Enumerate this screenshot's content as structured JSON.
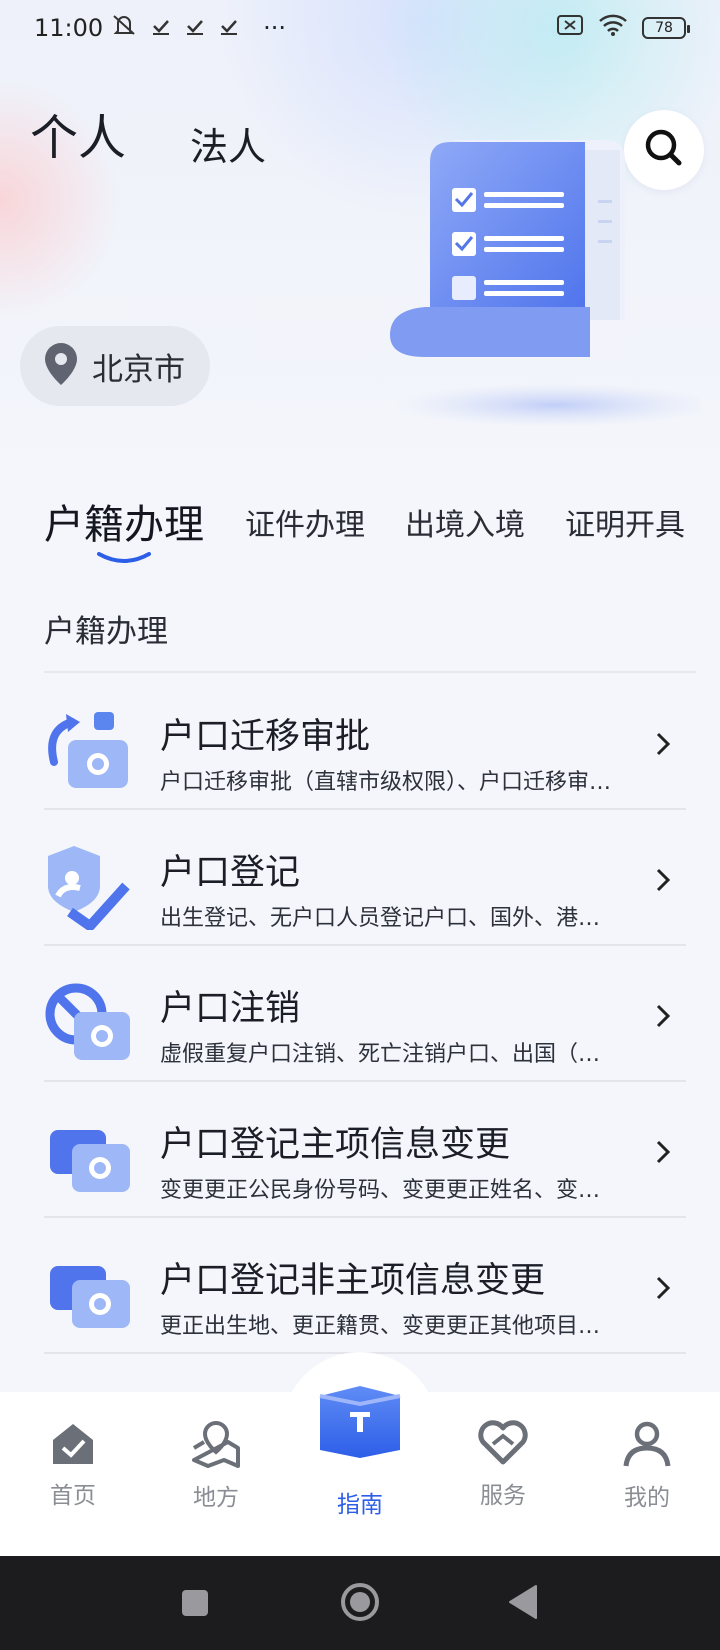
{
  "status_bar": {
    "time": "11:00",
    "ellipsis": "···",
    "battery": "78",
    "icons": [
      "mute-icon",
      "check-icon",
      "check-icon",
      "check-icon",
      "sim-icon",
      "wifi-icon",
      "battery-icon"
    ]
  },
  "top_tabs": [
    {
      "label": "个人",
      "active": true
    },
    {
      "label": "法人",
      "active": false
    }
  ],
  "location": {
    "label": "北京市"
  },
  "category_tabs": [
    {
      "label": "户籍办理",
      "active": true
    },
    {
      "label": "证件办理",
      "active": false
    },
    {
      "label": "出境入境",
      "active": false
    },
    {
      "label": "证明开具",
      "active": false
    }
  ],
  "section_title": "户籍办理",
  "items": [
    {
      "title": "户口迁移审批",
      "desc": "户口迁移审批（直辖市级权限）、户口迁移审批（非直辖市级权限）",
      "icon": "transfer-icon"
    },
    {
      "title": "户口登记",
      "desc": "出生登记、无户口人员登记户口、国外、港澳台人员恢复户口登记",
      "icon": "register-icon"
    },
    {
      "title": "户口注销",
      "desc": "虚假重复户口注销、死亡注销户口、出国（境）定居注销户口",
      "icon": "cancel-icon"
    },
    {
      "title": "户口登记主项信息变更",
      "desc": "变更更正公民身份号码、变更更正姓名、变更更正出生日期",
      "icon": "change-main-icon"
    },
    {
      "title": "户口登记非主项信息变更",
      "desc": "更正出生地、更正籍贯、变更更正其他项目信息变更",
      "icon": "change-minor-icon"
    }
  ],
  "bottom_nav": [
    {
      "label": "首页",
      "icon": "home-icon"
    },
    {
      "label": "地方",
      "icon": "map-pin-icon"
    },
    {
      "label": "指南",
      "icon": "guide-book-icon",
      "active": true
    },
    {
      "label": "服务",
      "icon": "service-heart-icon"
    },
    {
      "label": "我的",
      "icon": "profile-icon"
    }
  ],
  "colors": {
    "accent": "#2d5ee8",
    "nav_inactive": "#8a8d94",
    "icon_blue": "#5b86f0"
  }
}
